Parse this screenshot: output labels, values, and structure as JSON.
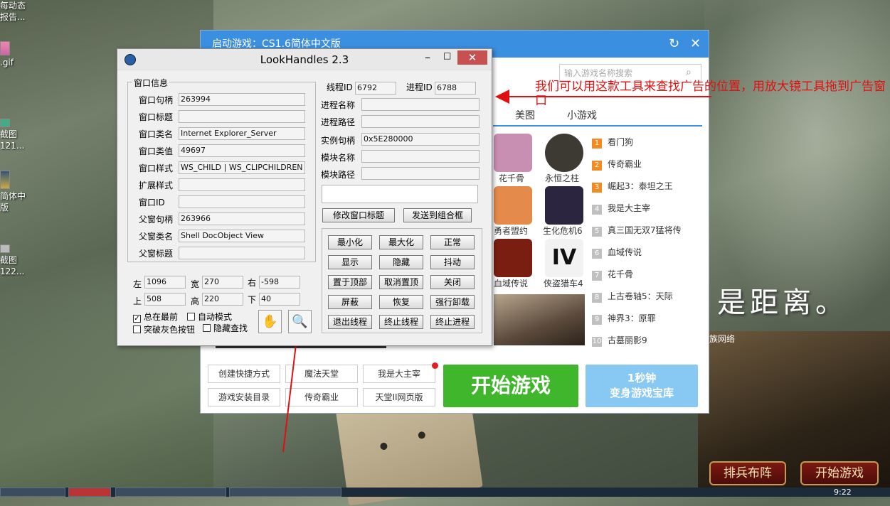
{
  "desktop": {
    "icons": [
      {
        "line1": "每动态",
        "line2": "报告..."
      },
      {
        "line1": ".gif",
        "line2": ""
      },
      {
        "line1": "截图",
        "line2": "121..."
      },
      {
        "line1": "简体中",
        "line2": "版"
      },
      {
        "line1": "截图",
        "line2": "122..."
      }
    ],
    "overlay_text": "是距离。"
  },
  "game_ad": {
    "logo": "游族网络",
    "buttons": [
      "排兵布阵",
      "开始游戏"
    ]
  },
  "taskbar": {
    "clock": "9:22"
  },
  "launcher": {
    "title": "启动游戏：CS1.6简体中文版",
    "refresh_icon": "↻",
    "close_icon": "✕",
    "search_placeholder": "输入游戏名称搜索",
    "tabs": [
      "美图",
      "小游戏"
    ],
    "games": [
      {
        "name": "花千骨",
        "color": "#c98fb3"
      },
      {
        "name": "永恒之柱",
        "color": "#3d3a33"
      },
      {
        "name": "勇者盟约",
        "color": "#e48a4a"
      },
      {
        "name": "生化危机6",
        "color": "#2b2540"
      },
      {
        "name": "血域传说",
        "color": "#7a1e12"
      },
      {
        "name": "侠盗猎车4",
        "color": "#f2f2f2"
      }
    ],
    "ranking": [
      {
        "rank": "1",
        "name": "看门狗"
      },
      {
        "rank": "2",
        "name": "传奇霸业"
      },
      {
        "rank": "3",
        "name": "崛起3：泰坦之王"
      },
      {
        "rank": "4",
        "name": "我是大主宰"
      },
      {
        "rank": "5",
        "name": "真三国无双7猛将传"
      },
      {
        "rank": "6",
        "name": "血域传说"
      },
      {
        "rank": "7",
        "name": "花千骨"
      },
      {
        "rank": "8",
        "name": "上古卷轴5：天际"
      },
      {
        "rank": "9",
        "name": "神界3：原罪"
      },
      {
        "rank": "10",
        "name": "古墓丽影9"
      }
    ],
    "links": [
      "创建快捷方式",
      "魔法天堂",
      "我是大主宰",
      "游戏安装目录",
      "传奇霸业",
      "天堂II网页版"
    ],
    "start_button": "开始游戏",
    "treasure_line1": "1秒钟",
    "treasure_line2": "变身游戏宝库"
  },
  "annotation": "我们可以用这款工具来查找广告的位置，用放大镜工具拖到广告窗口",
  "lookhandles": {
    "title": "LookHandles 2.3",
    "min": "–",
    "max": "□",
    "close": "✕",
    "window_info_label": "窗口信息",
    "rows": [
      {
        "label": "窗口句柄",
        "value": "263994"
      },
      {
        "label": "窗口标题",
        "value": ""
      },
      {
        "label": "窗口类名",
        "value": "Internet Explorer_Server"
      },
      {
        "label": "窗口类值",
        "value": "49697"
      },
      {
        "label": "窗口样式",
        "value": "WS_CHILD | WS_CLIPCHILDREN | W"
      },
      {
        "label": "扩展样式",
        "value": ""
      },
      {
        "label": "窗口ID",
        "value": ""
      },
      {
        "label": "父窗句柄",
        "value": "263966"
      },
      {
        "label": "父窗类名",
        "value": "Shell DocObject View"
      },
      {
        "label": "父窗标题",
        "value": ""
      }
    ],
    "geom": {
      "left_label": "左",
      "left": "1096",
      "width_label": "宽",
      "width": "270",
      "right_label": "右",
      "right": "-598",
      "top_label": "上",
      "top": "508",
      "height_label": "高",
      "height": "220",
      "bottom_label": "下",
      "bottom": "40"
    },
    "thread_label": "线程ID",
    "thread_id": "6792",
    "process_label": "进程ID",
    "process_id": "6788",
    "proc_rows": [
      {
        "label": "进程名称",
        "value": ""
      },
      {
        "label": "进程路径",
        "value": ""
      },
      {
        "label": "实例句柄",
        "value": "0x5E280000"
      },
      {
        "label": "模块名称",
        "value": ""
      },
      {
        "label": "模块路径",
        "value": ""
      }
    ],
    "edit_title_btn": "修改窗口标题",
    "send_combo_btn": "发送到组合框",
    "action_buttons": [
      "最小化",
      "最大化",
      "正常",
      "显示",
      "隐藏",
      "抖动",
      "置于顶部",
      "取消置顶",
      "关闭",
      "屏蔽",
      "恢复",
      "强行卸载",
      "退出线程",
      "终止线程",
      "终止进程"
    ],
    "chk_topmost": "总在最前",
    "chk_topmost_checked": "✓",
    "chk_auto": "自动模式",
    "chk_break_gray": "突破灰色按钮",
    "chk_hide_find": "隐藏查找",
    "hand_icon": "✋",
    "magnifier_icon": "🔍"
  }
}
